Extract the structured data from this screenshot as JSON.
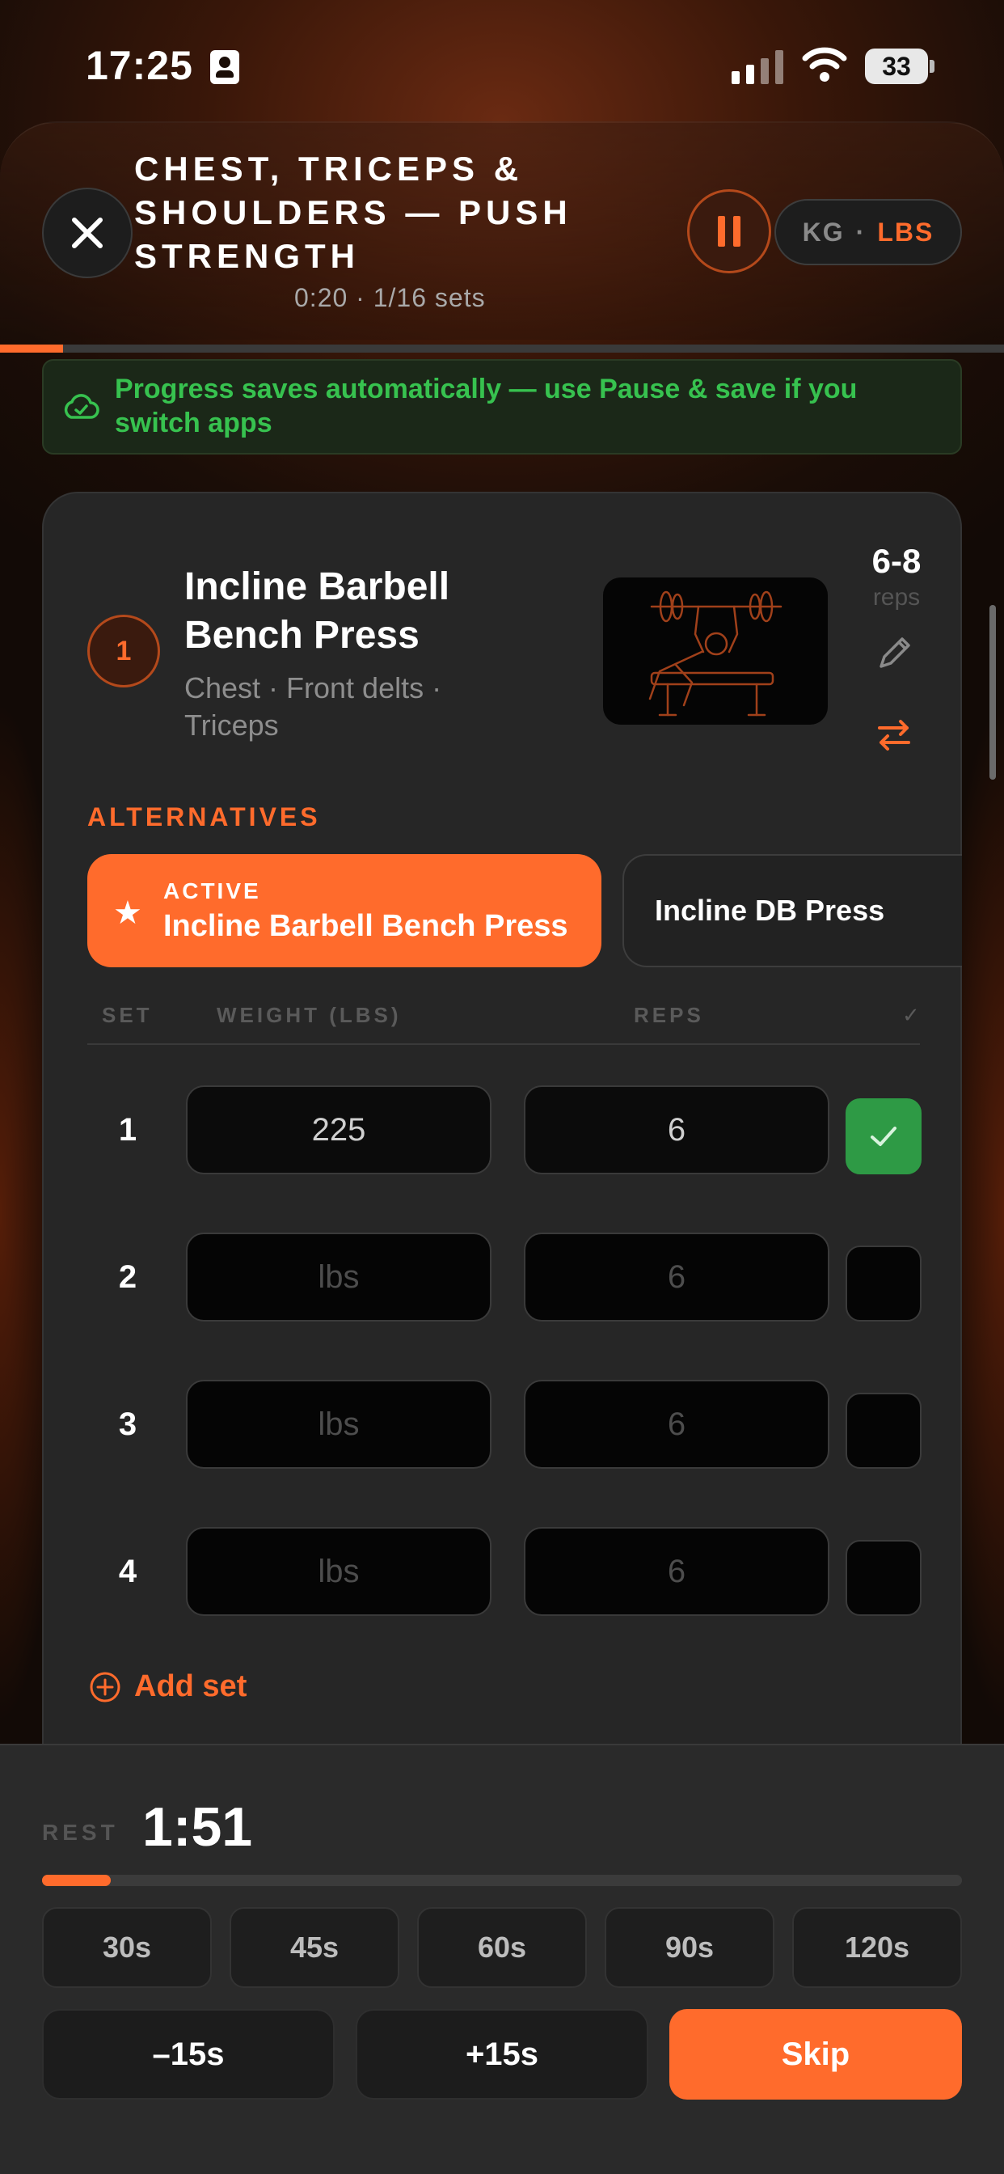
{
  "status_bar": {
    "time": "17:25",
    "battery": "33"
  },
  "header": {
    "title": "CHEST, TRICEPS & SHOULDERS — PUSH STRENGTH",
    "elapsed": "0:20",
    "sets_progress": "1/16 sets",
    "separator": "·",
    "unit_kg": "KG",
    "unit_lbs": "LBS",
    "active_unit": "LBS",
    "workout_progress_fraction": 0.0625
  },
  "autosave_banner": {
    "text": "Progress saves automatically — use Pause & save if you switch apps"
  },
  "exercise": {
    "number": "1",
    "name": "Incline Barbell Bench Press",
    "muscles": "Chest · Front delts · Triceps",
    "rep_range": "6-8",
    "rep_unit": "reps",
    "image_icon": "bench-press-illustration"
  },
  "alternatives": {
    "label": "ALTERNATIVES",
    "active_tag": "ACTIVE",
    "active_name": "Incline Barbell Bench Press",
    "other": "Incline DB Press"
  },
  "set_table": {
    "headers": {
      "set": "SET",
      "weight": "WEIGHT (LBS)",
      "reps": "REPS",
      "check": "✓"
    },
    "rows": [
      {
        "set": "1",
        "weight": "225",
        "reps": "6",
        "done": true
      },
      {
        "set": "2",
        "weight": "lbs",
        "reps": "6",
        "done": false
      },
      {
        "set": "3",
        "weight": "lbs",
        "reps": "6",
        "done": false
      },
      {
        "set": "4",
        "weight": "lbs",
        "reps": "6",
        "done": false
      }
    ],
    "add_set": "Add set"
  },
  "rest": {
    "label": "REST",
    "time": "1:51",
    "progress_fraction": 0.075,
    "presets": [
      "30s",
      "45s",
      "60s",
      "90s",
      "120s"
    ],
    "minus": "–15s",
    "plus": "+15s",
    "skip": "Skip"
  },
  "colors": {
    "accent": "#ff6b2c",
    "success": "#2e9a45",
    "banner_text": "#37c24f"
  }
}
